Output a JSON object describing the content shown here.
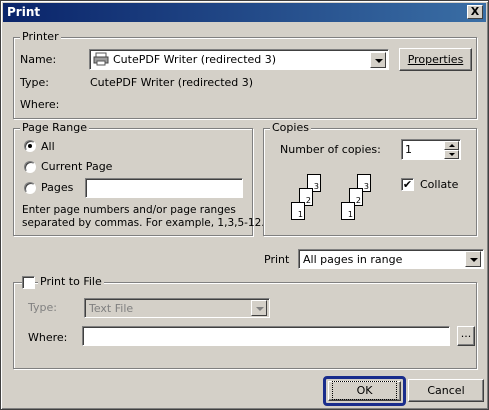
{
  "window": {
    "title": "Print",
    "close_glyph": "X"
  },
  "printer": {
    "legend": "Printer",
    "name_label": "Name:",
    "name_value": "CutePDF Writer (redirected 3)",
    "properties_label": "Properties",
    "type_label": "Type:",
    "type_value": "CutePDF Writer (redirected 3)",
    "where_label": "Where:"
  },
  "page_range": {
    "legend": "Page Range",
    "all_label": "All",
    "current_label": "Current Page",
    "pages_label": "Pages",
    "pages_value": "",
    "hint_line1": "Enter page numbers and/or page ranges",
    "hint_line2": "separated by commas.  For example, 1,3,5-12.",
    "selected": "all"
  },
  "copies": {
    "legend": "Copies",
    "number_label": "Number of copies:",
    "number_value": "1",
    "collate_label": "Collate",
    "collate_checked": true,
    "check_glyph": "✔",
    "stack_pages": [
      "3",
      "2",
      "1"
    ]
  },
  "print_select": {
    "label": "Print",
    "value": "All pages in range"
  },
  "print_to_file": {
    "legend": "Print to File",
    "checked": false,
    "type_label": "Type:",
    "type_value": "Text File",
    "where_label": "Where:",
    "where_value": "",
    "browse_label": "..."
  },
  "buttons": {
    "ok": "OK",
    "cancel": "Cancel"
  },
  "colors": {
    "titlebar": "#0a246a",
    "face": "#d4d0c8",
    "focus_ring": "#1a2d8c"
  }
}
